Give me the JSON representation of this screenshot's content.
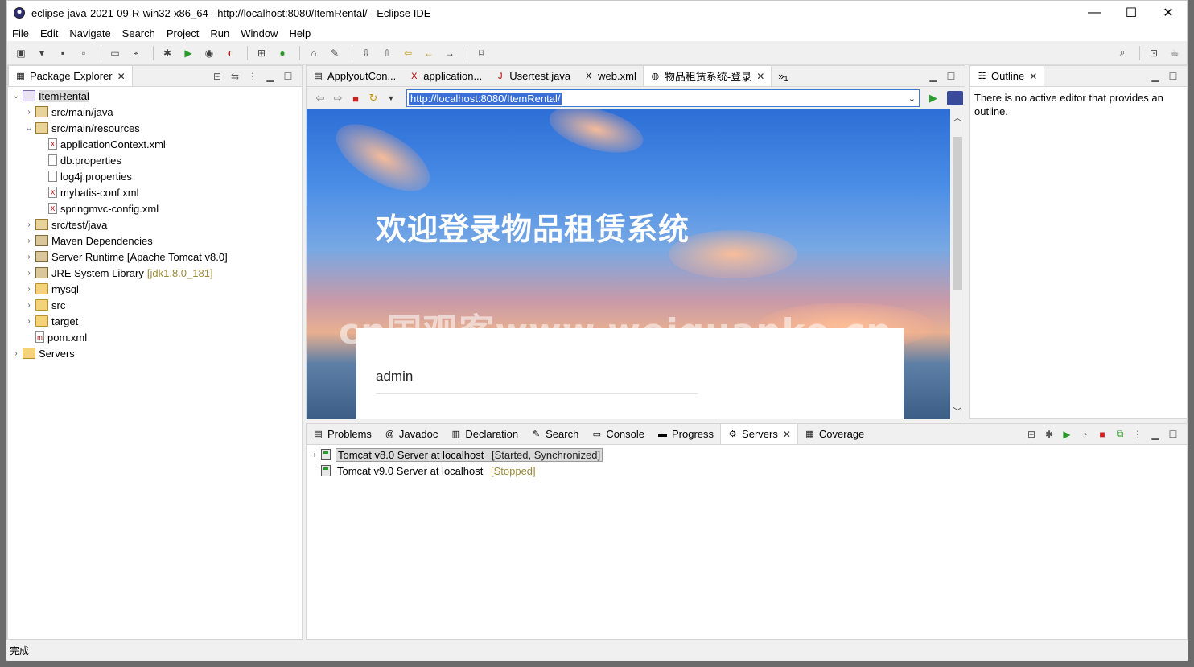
{
  "window": {
    "title": "eclipse-java-2021-09-R-win32-x86_64 - http://localhost:8080/ItemRental/ - Eclipse IDE",
    "controls": {
      "minimize": "—",
      "maximize": "☐",
      "close": "✕"
    }
  },
  "menu": [
    "File",
    "Edit",
    "Navigate",
    "Search",
    "Project",
    "Run",
    "Window",
    "Help"
  ],
  "package_explorer": {
    "tab_label": "Package Explorer",
    "tree": [
      {
        "label": "ItemRental",
        "expanded": true,
        "selected": true,
        "icon": "project-icon"
      },
      {
        "label": "src/main/java",
        "icon": "source-folder-icon"
      },
      {
        "label": "src/main/resources",
        "expanded": true,
        "icon": "source-folder-icon"
      },
      {
        "label": "applicationContext.xml",
        "icon": "xml-file-icon"
      },
      {
        "label": "db.properties",
        "icon": "properties-file-icon"
      },
      {
        "label": "log4j.properties",
        "icon": "properties-file-icon"
      },
      {
        "label": "mybatis-conf.xml",
        "icon": "xml-file-icon"
      },
      {
        "label": "springmvc-config.xml",
        "icon": "xml-file-icon"
      },
      {
        "label": "src/test/java",
        "icon": "source-folder-icon"
      },
      {
        "label": "Maven Dependencies",
        "icon": "library-icon"
      },
      {
        "label": "Server Runtime [Apache Tomcat v8.0]",
        "icon": "library-icon"
      },
      {
        "label": "JRE System Library",
        "extra": "[jdk1.8.0_181]",
        "icon": "library-icon"
      },
      {
        "label": "mysql",
        "icon": "folder-icon"
      },
      {
        "label": "src",
        "icon": "folder-icon"
      },
      {
        "label": "target",
        "icon": "folder-icon"
      },
      {
        "label": "pom.xml",
        "icon": "xml-file-icon"
      },
      {
        "label": "Servers",
        "icon": "folder-icon"
      }
    ]
  },
  "editor": {
    "tabs": [
      "ApplyoutCon...",
      "application...",
      "Usertest.java",
      "web.xml",
      "物品租赁系统-登录"
    ],
    "overflow": "»",
    "overflow_count": "1",
    "url": "http://localhost:8080/ItemRental/",
    "page": {
      "heading": "欢迎登录物品租赁系统",
      "username_value": "admin",
      "watermark": "cn国观客www.weiguanke.cn"
    }
  },
  "outline": {
    "tab_label": "Outline",
    "message": "There is no active editor that provides an outline."
  },
  "bottom": {
    "tabs": [
      "Problems",
      "Javadoc",
      "Declaration",
      "Search",
      "Console",
      "Progress",
      "Servers",
      "Coverage"
    ],
    "servers": [
      {
        "name": "Tomcat v8.0 Server at localhost",
        "state": "[Started, Synchronized]"
      },
      {
        "name": "Tomcat v9.0 Server at localhost",
        "state": "[Stopped]"
      }
    ]
  },
  "status_bar": {
    "text": "完成"
  }
}
